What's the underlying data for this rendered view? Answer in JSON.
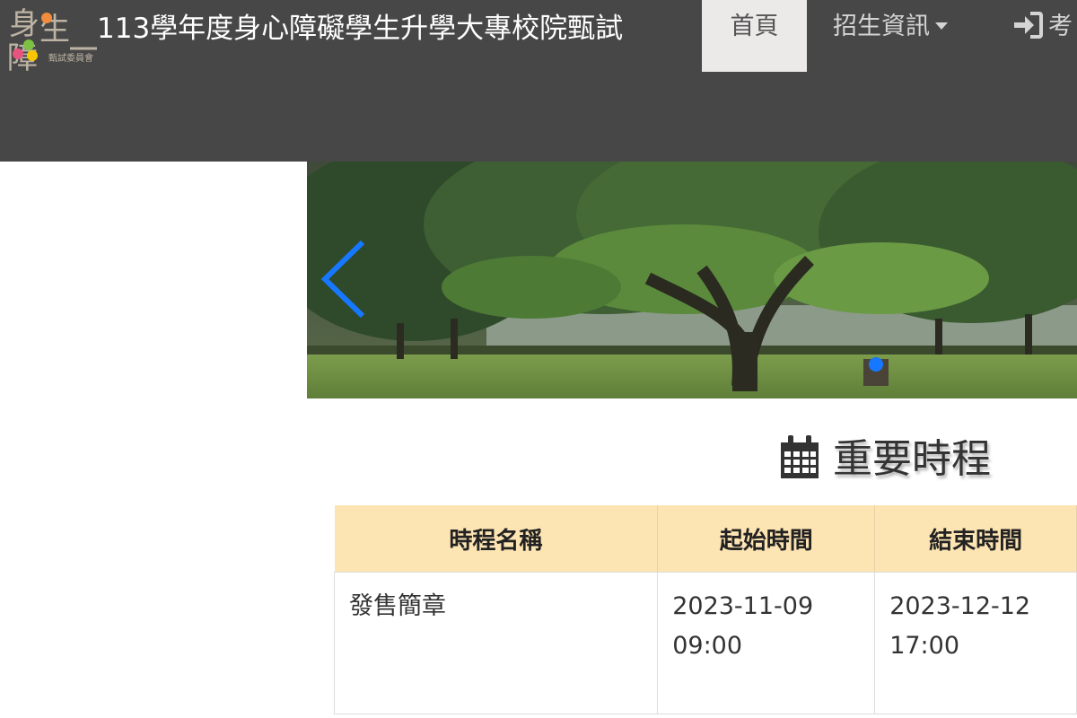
{
  "header": {
    "site_title": "113學年度身心障礙學生升學大專校院甄試",
    "logo_small_text": "甄試委員會"
  },
  "nav": {
    "home": "首頁",
    "admission_info": "招生資訊",
    "exam_login": "考"
  },
  "section": {
    "title": "重要時程"
  },
  "schedule": {
    "headers": [
      "時程名稱",
      "起始時間",
      "結束時間"
    ],
    "rows": [
      {
        "name": "發售簡章",
        "start_date": "2023-11-09",
        "start_time": "09:00",
        "end_date": "2023-12-12",
        "end_time": "17:00"
      }
    ]
  },
  "colors": {
    "navbar": "#474747",
    "active_tab": "#ece9e9",
    "table_header": "#fde4b3",
    "accent_blue": "#1677ff"
  }
}
